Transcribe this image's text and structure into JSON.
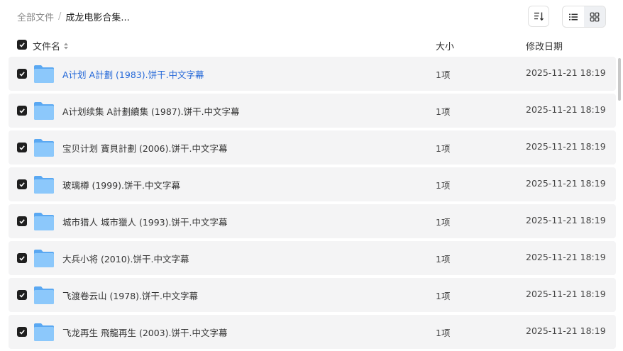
{
  "breadcrumb": {
    "root": "全部文件",
    "separator": "/",
    "current": "成龙电影合集..."
  },
  "toolbar": {
    "sort_icon": "sort-icon",
    "list_view_icon": "list-view-icon",
    "grid_view_icon": "grid-view-icon",
    "active_view": "list"
  },
  "table": {
    "columns": {
      "name": "文件名",
      "size": "大小",
      "date": "修改日期"
    },
    "rows": [
      {
        "name": "A计划 A計劃 (1983).饼干.中文字幕",
        "size": "1项",
        "date": "2025-11-21 18:19",
        "highlight": true
      },
      {
        "name": "A计划续集 A計劃續集 (1987).饼干.中文字幕",
        "size": "1项",
        "date": "2025-11-21 18:19",
        "highlight": false
      },
      {
        "name": "宝贝计划 寶貝計劃 (2006).饼干.中文字幕",
        "size": "1项",
        "date": "2025-11-21 18:19",
        "highlight": false
      },
      {
        "name": "玻璃樽 (1999).饼干.中文字幕",
        "size": "1项",
        "date": "2025-11-21 18:19",
        "highlight": false
      },
      {
        "name": "城市猎人 城市獵人 (1993).饼干.中文字幕",
        "size": "1项",
        "date": "2025-11-21 18:19",
        "highlight": false
      },
      {
        "name": "大兵小将 (2010).饼干.中文字幕",
        "size": "1项",
        "date": "2025-11-21 18:19",
        "highlight": false
      },
      {
        "name": "飞渡卷云山 (1978).饼干.中文字幕",
        "size": "1项",
        "date": "2025-11-21 18:19",
        "highlight": false
      },
      {
        "name": "飞龙再生 飛龍再生 (2003).饼干.中文字幕",
        "size": "1项",
        "date": "2025-11-21 18:19",
        "highlight": false
      }
    ]
  },
  "colors": {
    "row_bg": "#f4f4f5",
    "link": "#2468d8",
    "checkbox": "#1f1f1f",
    "folder": "#6fb3f5"
  }
}
